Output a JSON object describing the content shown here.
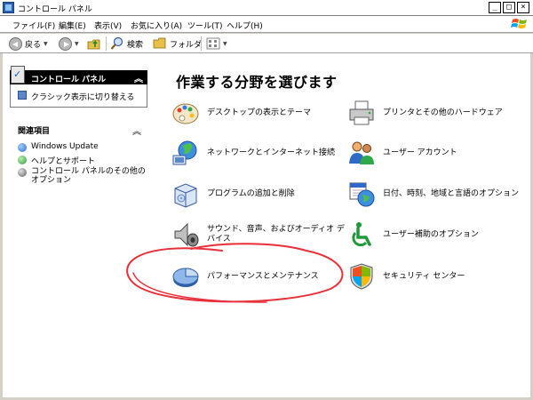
{
  "window": {
    "title": "コントロール パネル",
    "controls": {
      "minimize": "_",
      "maximize": "□",
      "close": "×"
    }
  },
  "menubar": {
    "items": [
      "ファイル(F)",
      "編集(E)",
      "表示(V)",
      "お気に入り(A)",
      "ツール(T)",
      "ヘルプ(H)"
    ]
  },
  "toolbar": {
    "back_label": "戻る",
    "search_label": "検索",
    "folders_label": "フォルダ",
    "dropdown_glyph": "▼"
  },
  "sidebar": {
    "panel_title": "コントロール パネル",
    "switch_view_label": "クラシック表示に切り替える",
    "related_title": "関連項目",
    "collapse_glyph": "︽",
    "related_items": [
      "Windows Update",
      "ヘルプとサポート",
      "コントロール パネルのその他のオプション"
    ]
  },
  "main": {
    "heading": "作業する分野を選びます",
    "categories": [
      "デスクトップの表示とテーマ",
      "プリンタとその他のハードウェア",
      "ネットワークとインターネット接続",
      "ユーザー アカウント",
      "プログラムの追加と削除",
      "日付、時刻、地域と言語のオプション",
      "サウンド、音声、およびオーディオ デバイス",
      "ユーザー補助のオプション",
      "パフォーマンスとメンテナンス",
      "セキュリティ センター"
    ]
  },
  "colors": {
    "annotation_circle": "#e8303a",
    "accent_blue": "#2f6bc6"
  }
}
